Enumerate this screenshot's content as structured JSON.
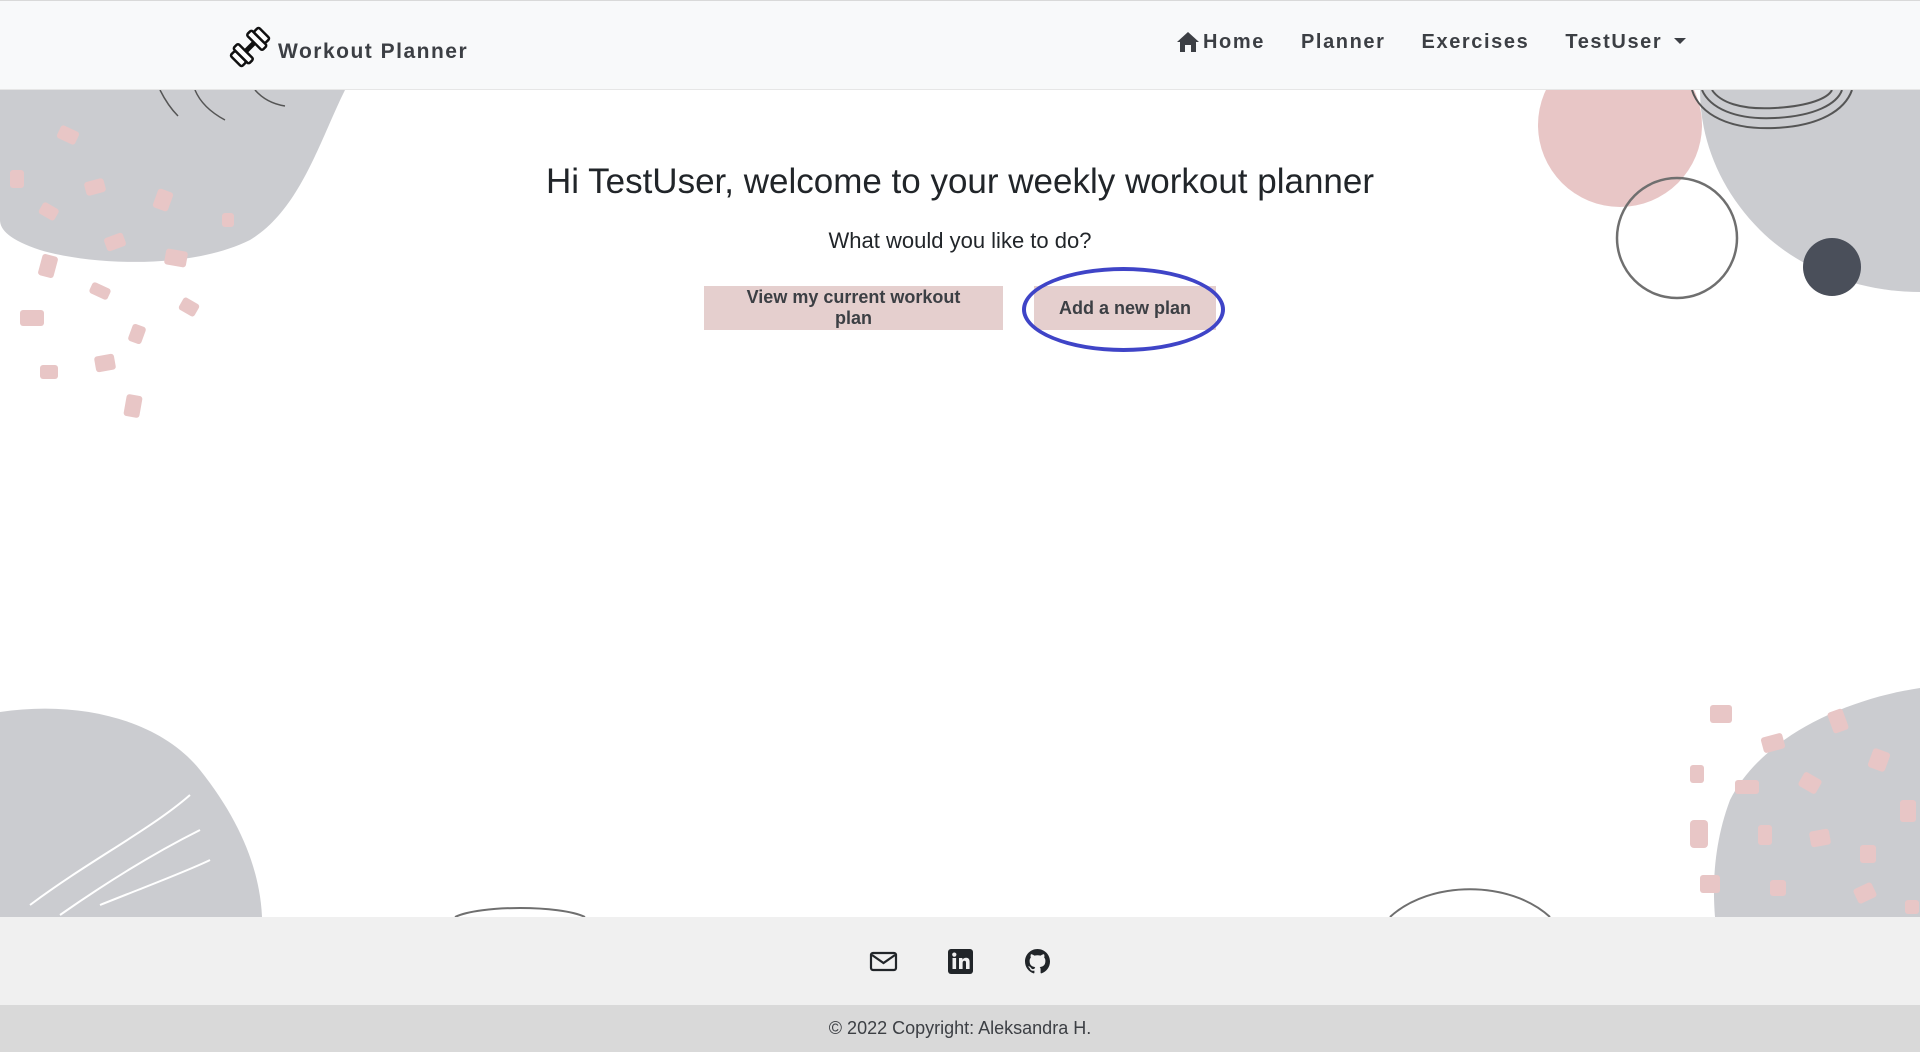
{
  "navbar": {
    "brand": "Workout Planner",
    "brand_icon": "dumbbell-icon",
    "links": {
      "home": "Home",
      "planner": "Planner",
      "exercises": "Exercises",
      "user": "TestUser"
    }
  },
  "main": {
    "welcome": "Hi TestUser, welcome to your weekly workout planner",
    "question": "What would you like to do?",
    "buttons": {
      "view_plan": "View my current workout plan",
      "add_plan": "Add a new plan"
    }
  },
  "footer": {
    "icons": [
      "envelope-icon",
      "linkedin-icon",
      "github-icon"
    ],
    "copyright": "© 2022 Copyright: Aleksandra H."
  },
  "colors": {
    "accent_button": "#e5cfce",
    "highlight": "#3f44c7",
    "nav_background": "#f8f9fa",
    "text_dark": "#3c3f44"
  }
}
